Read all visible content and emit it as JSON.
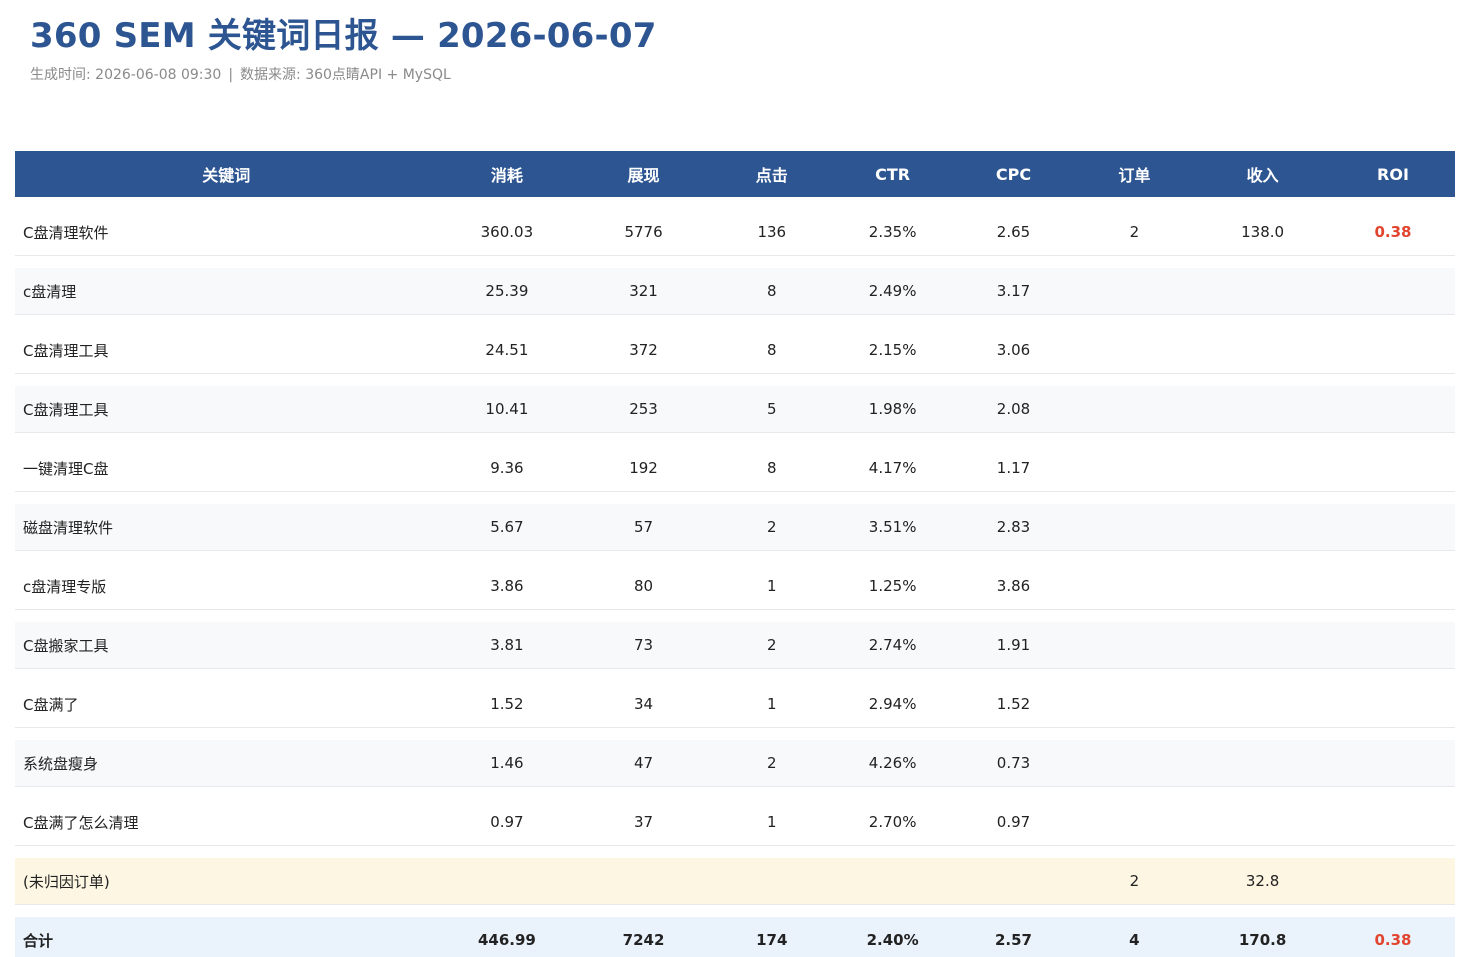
{
  "report": {
    "title": "360 SEM 关键词日报 — 2026-06-07",
    "generated_label": "生成时间: 2026-06-08 09:30",
    "separator": "|",
    "source_label": "数据来源: 360点睛API + MySQL"
  },
  "table": {
    "headers": [
      "关键词",
      "消耗",
      "展现",
      "点击",
      "CTR",
      "CPC",
      "订单",
      "收入",
      "ROI"
    ],
    "rows": [
      {
        "keyword": "C盘清理软件",
        "cost": "360.03",
        "impressions": "5776",
        "clicks": "136",
        "ctr": "2.35%",
        "cpc": "2.65",
        "orders": "2",
        "revenue": "138.0",
        "roi": "0.38"
      },
      {
        "keyword": "c盘清理",
        "cost": "25.39",
        "impressions": "321",
        "clicks": "8",
        "ctr": "2.49%",
        "cpc": "3.17",
        "orders": "",
        "revenue": "",
        "roi": ""
      },
      {
        "keyword": "C盘清理工具",
        "cost": "24.51",
        "impressions": "372",
        "clicks": "8",
        "ctr": "2.15%",
        "cpc": "3.06",
        "orders": "",
        "revenue": "",
        "roi": ""
      },
      {
        "keyword": "C盘清理工具",
        "cost": "10.41",
        "impressions": "253",
        "clicks": "5",
        "ctr": "1.98%",
        "cpc": "2.08",
        "orders": "",
        "revenue": "",
        "roi": ""
      },
      {
        "keyword": "一键清理C盘",
        "cost": "9.36",
        "impressions": "192",
        "clicks": "8",
        "ctr": "4.17%",
        "cpc": "1.17",
        "orders": "",
        "revenue": "",
        "roi": ""
      },
      {
        "keyword": "磁盘清理软件",
        "cost": "5.67",
        "impressions": "57",
        "clicks": "2",
        "ctr": "3.51%",
        "cpc": "2.83",
        "orders": "",
        "revenue": "",
        "roi": ""
      },
      {
        "keyword": "c盘清理专版",
        "cost": "3.86",
        "impressions": "80",
        "clicks": "1",
        "ctr": "1.25%",
        "cpc": "3.86",
        "orders": "",
        "revenue": "",
        "roi": ""
      },
      {
        "keyword": "C盘搬家工具",
        "cost": "3.81",
        "impressions": "73",
        "clicks": "2",
        "ctr": "2.74%",
        "cpc": "1.91",
        "orders": "",
        "revenue": "",
        "roi": ""
      },
      {
        "keyword": "C盘满了",
        "cost": "1.52",
        "impressions": "34",
        "clicks": "1",
        "ctr": "2.94%",
        "cpc": "1.52",
        "orders": "",
        "revenue": "",
        "roi": ""
      },
      {
        "keyword": "系统盘瘦身",
        "cost": "1.46",
        "impressions": "47",
        "clicks": "2",
        "ctr": "4.26%",
        "cpc": "0.73",
        "orders": "",
        "revenue": "",
        "roi": ""
      },
      {
        "keyword": "C盘满了怎么清理",
        "cost": "0.97",
        "impressions": "37",
        "clicks": "1",
        "ctr": "2.70%",
        "cpc": "0.97",
        "orders": "",
        "revenue": "",
        "roi": ""
      }
    ],
    "unattributed": {
      "keyword": "(未归因订单)",
      "cost": "",
      "impressions": "",
      "clicks": "",
      "ctr": "",
      "cpc": "",
      "orders": "2",
      "revenue": "32.8",
      "roi": ""
    },
    "total": {
      "keyword": "合计",
      "cost": "446.99",
      "impressions": "7242",
      "clicks": "174",
      "ctr": "2.40%",
      "cpc": "2.57",
      "orders": "4",
      "revenue": "170.8",
      "roi": "0.38"
    }
  },
  "colors": {
    "header_bg": "#2c5592",
    "title": "#2c5592",
    "roi_warning": "#e2452f",
    "unattributed_bg": "#fdf6e3",
    "total_bg": "#eaf2fc"
  }
}
